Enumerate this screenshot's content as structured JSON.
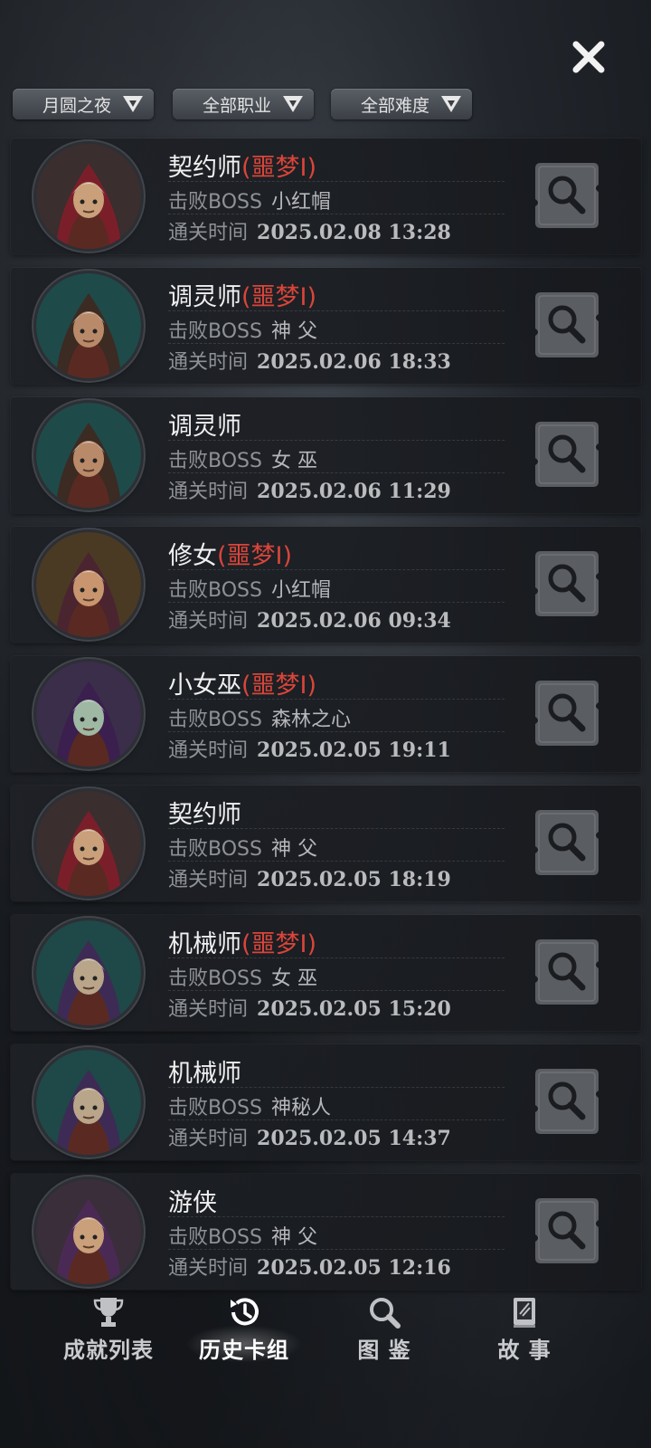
{
  "close": {
    "icon": "close-icon"
  },
  "filters": [
    {
      "label": "月圆之夜",
      "icon": "filter-dropdown-icon"
    },
    {
      "label": "全部职业",
      "icon": "filter-dropdown-icon"
    },
    {
      "label": "全部难度",
      "icon": "filter-dropdown-icon"
    }
  ],
  "labels": {
    "boss": "击败BOSS",
    "time": "通关时间"
  },
  "records": [
    {
      "name": "契约师",
      "difficulty": "(噩梦I)",
      "boss": "小红帽",
      "time": "2025.02.08 13:28",
      "avatar": "warlock",
      "hood": "#7a1f2a"
    },
    {
      "name": "调灵师",
      "difficulty": "(噩梦I)",
      "boss": "神 父",
      "time": "2025.02.06 18:33",
      "avatar": "medium",
      "hood": "#3b2b22"
    },
    {
      "name": "调灵师",
      "difficulty": "",
      "boss": "女 巫",
      "time": "2025.02.06 11:29",
      "avatar": "medium",
      "hood": "#3b2b22"
    },
    {
      "name": "修女",
      "difficulty": "(噩梦I)",
      "boss": "小红帽",
      "time": "2025.02.06 09:34",
      "avatar": "nun",
      "hood": "#4a2530"
    },
    {
      "name": "小女巫",
      "difficulty": "(噩梦I)",
      "boss": "森林之心",
      "time": "2025.02.05 19:11",
      "avatar": "little-witch",
      "hood": "#3b1f4e"
    },
    {
      "name": "契约师",
      "difficulty": "",
      "boss": "神 父",
      "time": "2025.02.05 18:19",
      "avatar": "warlock",
      "hood": "#7a1f2a"
    },
    {
      "name": "机械师",
      "difficulty": "(噩梦I)",
      "boss": "女 巫",
      "time": "2025.02.05 15:20",
      "avatar": "mechanic",
      "hood": "#3d2b55"
    },
    {
      "name": "机械师",
      "difficulty": "",
      "boss": "神秘人",
      "time": "2025.02.05 14:37",
      "avatar": "mechanic",
      "hood": "#3d2b55"
    },
    {
      "name": "游侠",
      "difficulty": "",
      "boss": "神 父",
      "time": "2025.02.05 12:16",
      "avatar": "ranger",
      "hood": "#4a2a55"
    }
  ],
  "nav": [
    {
      "label": "成就列表",
      "icon": "trophy-icon",
      "active": false
    },
    {
      "label": "历史卡组",
      "icon": "history-icon",
      "active": true
    },
    {
      "label": "图 鉴",
      "icon": "magnifier-icon",
      "active": false
    },
    {
      "label": "故 事",
      "icon": "book-icon",
      "active": false
    }
  ],
  "colors": {
    "accent": "#d9453a",
    "panel": "#1e2126",
    "text": "#f0f0f0",
    "muted": "#8e9196"
  }
}
